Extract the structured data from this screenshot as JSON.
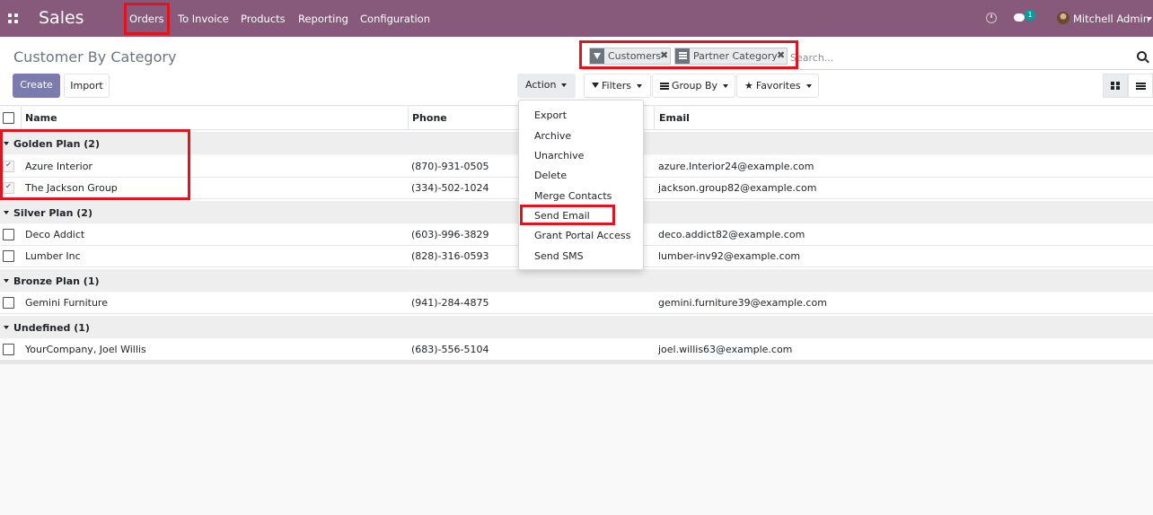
{
  "navbar": {
    "brand": "Sales",
    "menu": [
      "Orders",
      "To Invoice",
      "Products",
      "Reporting",
      "Configuration"
    ],
    "chat_count": "1",
    "user": "Mitchell Admin"
  },
  "control_panel": {
    "title": "Customer By Category",
    "create_label": "Create",
    "import_label": "Import",
    "action_label": "Action",
    "filters_label": "Filters",
    "groupby_label": "Group By",
    "favorites_label": "Favorites"
  },
  "search": {
    "facets": [
      "Customers",
      "Partner Category"
    ],
    "placeholder": "Search..."
  },
  "table": {
    "columns": [
      "Name",
      "Phone",
      "Email"
    ],
    "groups": [
      {
        "label": "Golden Plan (2)",
        "rows": [
          {
            "name": "Azure Interior",
            "phone": "(870)-931-0505",
            "email": "azure.Interior24@example.com",
            "checked": true
          },
          {
            "name": "The Jackson Group",
            "phone": "(334)-502-1024",
            "email": "jackson.group82@example.com",
            "checked": true
          }
        ]
      },
      {
        "label": "Silver Plan (2)",
        "rows": [
          {
            "name": "Deco Addict",
            "phone": "(603)-996-3829",
            "email": "deco.addict82@example.com",
            "checked": false
          },
          {
            "name": "Lumber Inc",
            "phone": "(828)-316-0593",
            "email": "lumber-inv92@example.com",
            "checked": false
          }
        ]
      },
      {
        "label": "Bronze Plan (1)",
        "rows": [
          {
            "name": "Gemini Furniture",
            "phone": "(941)-284-4875",
            "email": "gemini.furniture39@example.com",
            "checked": false
          }
        ]
      },
      {
        "label": "Undefined (1)",
        "rows": [
          {
            "name": "YourCompany, Joel Willis",
            "phone": "(683)-556-5104",
            "email": "joel.willis63@example.com",
            "checked": false
          }
        ]
      }
    ]
  },
  "action_menu": [
    "Export",
    "Archive",
    "Unarchive",
    "Delete",
    "Merge Contacts",
    "Send Email",
    "Grant Portal Access",
    "Send SMS"
  ],
  "colors": {
    "navbar": "#875a7b",
    "primary": "#7c7bad",
    "highlight": "#e0141e"
  }
}
